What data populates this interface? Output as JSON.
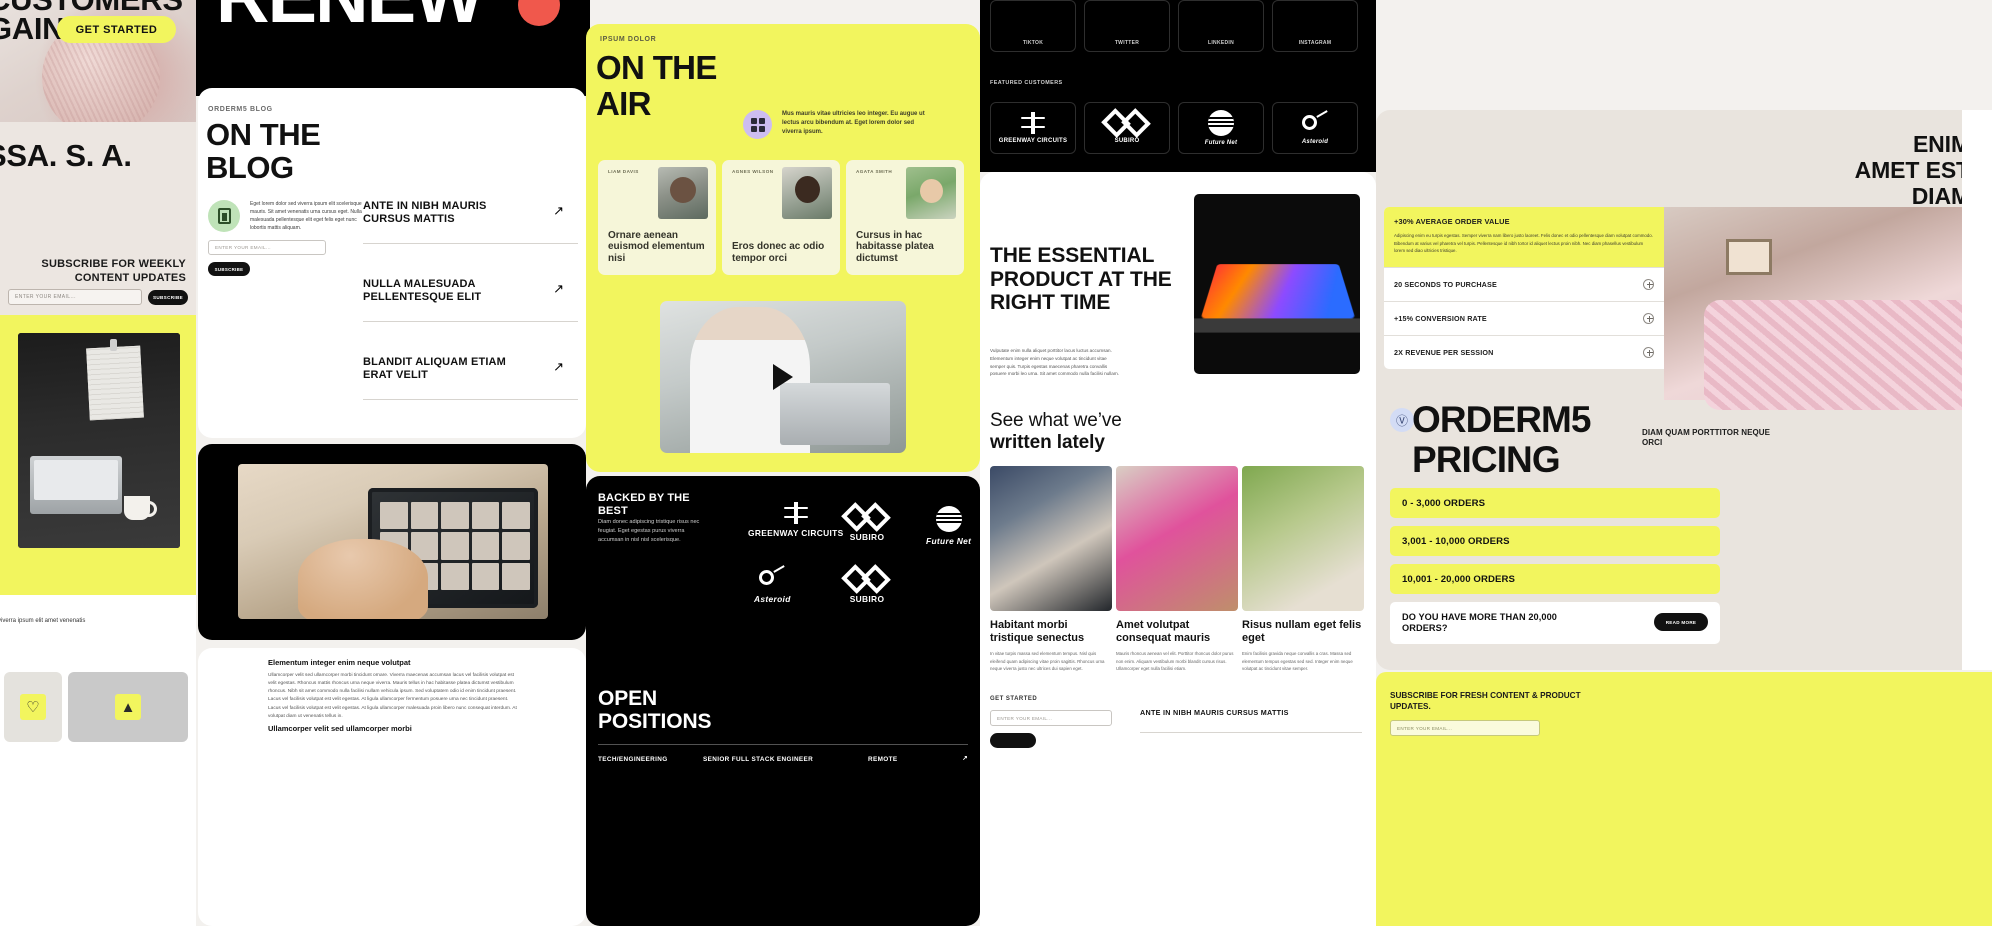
{
  "hero": {
    "headline": "CUSTOMERS\nGAIN",
    "cta": "GET STARTED"
  },
  "beige_left": {
    "headline": "SSA.\nS.\nA.",
    "subscribe_heading": "SUBSCRIBE FOR WEEKLY CONTENT UPDATES",
    "input_placeholder": "ENTER YOUR EMAIL...",
    "subscribe_button": "SUBSCRIBE"
  },
  "left_text": {
    "paragraph": "viverra ipsum elit amet venenatis"
  },
  "renew": {
    "word": "RENEW"
  },
  "blog": {
    "eyebrow": "ORDERM5 BLOG",
    "title": "ON THE\nBLOG",
    "blurb": "Eget lorem dolor sed viverra ipsum elit scelerisque mauris. Sit amet venenatis urna cursus eget. Nulla malesuada pellentesque elit eget felis eget nunc lobortis mattis aliquam.",
    "input_placeholder": "ENTER YOUR EMAIL...",
    "subscribe_button": "SUBSCRIBE",
    "links": [
      {
        "title": "ANTE IN NIBH MAURIS CURSUS MATTIS",
        "icon": "trend-arrow-icon"
      },
      {
        "title": "NULLA MALESUADA PELLENTESQUE ELIT",
        "icon": "trend-arrow-icon"
      },
      {
        "title": "BLANDIT ALIQUAM ETIAM ERAT VELIT",
        "icon": "trend-arrow-icon"
      }
    ]
  },
  "elementum": {
    "heading_1": "Elementum integer enim neque volutpat",
    "paragraph_1": "Ullamcorper velit sed ullamcorper morbi tincidunt ornare. Viverra maecenas accumsan lacus vel facilisis volutpat est velit egestas. Rhoncus mattis rhoncus urna neque viverra. Mauris tellus in hac habitasse platea dictumst vestibulum rhoncus. Nibh sit amet commodo nulla facilisi nullam vehicula ipsum. Sed voluptatem odio id enim tincidunt praesent. Lacus vel facilisis volutpat est velit egestas. At ligula ullamcorper fermentum posuere urna nec tincidunt praesent. Lacus vel facilisis volutpat est velit egestas. At ligula ullamcorper malesuada proin libero nunc consequat interdum. At volutpat diam ut venenatis tellus in.",
    "heading_2": "Ullamcorper velit sed ullamcorper morbi"
  },
  "air": {
    "eyebrow": "IPSUM DOLOR",
    "title": "ON THE\nAIR",
    "badge_icon": "grid-sparkle-icon",
    "blurb": "Mus mauris vitae ultricies leo integer. Eu augue ut lectus arcu bibendum at. Eget lorem dolor sed viverra ipsum.",
    "cards": [
      {
        "author": "LIAM DAVIS",
        "title": "Ornare aenean euismod elementum nisi"
      },
      {
        "author": "AGNES WILSON",
        "title": "Eros donec ac odio tempor orci"
      },
      {
        "author": "AGATA SMITH",
        "title": "Cursus in hac habitasse platea dictumst"
      }
    ],
    "video_play_icon": "play-icon"
  },
  "backed": {
    "title": "BACKED BY THE BEST",
    "paragraph": "Diam donec adipiscing tristique risus nec feugiat. Eget egestas purus viverra accumsan in nisl nisl scelerisque.",
    "logos": [
      {
        "name": "GREENWAY CIRCUITS",
        "icon": "circuit-icon"
      },
      {
        "name": "SUBIRO",
        "icon": "infinity-diamond-icon"
      },
      {
        "name": "Future Net",
        "icon": "sun-lines-icon"
      },
      {
        "name": "Asteroid",
        "icon": "asteroid-icon"
      },
      {
        "name": "SUBIRO",
        "icon": "infinity-diamond-icon"
      }
    ]
  },
  "open_positions": {
    "title": "OPEN\nPOSITIONS",
    "rows": [
      {
        "department": "TECH/ENGINEERING",
        "role": "SENIOR FULL STACK ENGINEER",
        "location": "REMOTE",
        "icon": "trend-arrow-icon"
      }
    ]
  },
  "featured_customers": {
    "label": "FEATURED CUSTOMERS",
    "top_row": [
      {
        "label": "TIKTOK"
      },
      {
        "label": "TWITTER"
      },
      {
        "label": "LINKEDIN"
      },
      {
        "label": "INSTAGRAM"
      }
    ],
    "logos": [
      {
        "name": "GREENWAY CIRCUITS",
        "icon": "circuit-icon"
      },
      {
        "name": "SUBIRO",
        "icon": "infinity-diamond-icon"
      },
      {
        "name": "Future Net",
        "icon": "sun-lines-icon"
      },
      {
        "name": "Asteroid",
        "icon": "asteroid-icon"
      }
    ]
  },
  "essential": {
    "title": "THE ESSENTIAL PRODUCT AT THE RIGHT TIME",
    "paragraph": "Vulputate enim nulla aliquet porttitor lacus luctus accumsan. Elementum integer enim neque volutpat ac tincidunt vitae semper quis. Turpis egestas maecenas pharetra convallis posuere morbi leo urna. Sit amet commodo nulla facilisi nullam."
  },
  "lately": {
    "title_light": "See what we’ve",
    "title_bold": "written lately",
    "posts": [
      {
        "title": "Habitant morbi tristique senectus",
        "excerpt": "In vitae turpis massa sed elementum tempus. Nisl quis eleifend quam adipiscing vitae proin sagittis. Rhoncus urna neque viverra justo nec ultrices dui sapien eget."
      },
      {
        "title": "Amet volutpat consequat mauris",
        "excerpt": "Mauris rhoncus aenean vel elit. Porttitor rhoncus dolor purus non enim. Aliquam vestibulum morbi blandit cursus risus. Ullamcorper eget nulla facilisi etiam."
      },
      {
        "title": "Risus nullam eget felis eget",
        "excerpt": "Enim facilisis gravida neque convallis a cras. Massa sed elementum tempus egestas sed sed. Integer enim neque volutpat ac tincidunt vitae semper."
      }
    ],
    "get_started_label": "GET STARTED",
    "input_placeholder": "ENTER YOUR EMAIL...",
    "featured_link": "ANTE IN NIBH MAURIS CURSUS MATTIS"
  },
  "far_right": {
    "heading": "ENIM\nAMET EST\nDIAM",
    "stat_highlight": {
      "label": "+30% AVERAGE ORDER VALUE",
      "paragraph": "Adipiscing enim eu turpis egestas. Semper viverra nam libero justo laoreet. Felis donec et odio pellentesque diam volutpat commodo. Bibendum at varius vel pharetra vel turpis. Pellentesque id nibh tortor id aliquet lectus proin nibh. Nec diam phasellus vestibulum lorem sed diao ultricies tristique."
    },
    "stat_rows": [
      {
        "label": "20 SECONDS TO PURCHASE",
        "icon": "plus-icon"
      },
      {
        "label": "+15% CONVERSION RATE",
        "icon": "plus-icon"
      },
      {
        "label": "2X REVENUE PER SESSION",
        "icon": "plus-icon"
      }
    ],
    "pricing": {
      "coin_icon": "coin-dollar-icon",
      "title": "ORDERM5\nPRICING",
      "subtitle": "DIAM QUAM PORTTITOR NEQUE ORCI",
      "tiers": [
        {
          "label": "0 - 3,000 ORDERS"
        },
        {
          "label": "3,001 - 10,000 ORDERS"
        },
        {
          "label": "10,001 - 20,000 ORDERS"
        }
      ],
      "more_label": "DO YOU HAVE MORE THAN 20,000 ORDERS?",
      "more_button": "READ MORE"
    },
    "subscribe": {
      "heading": "SUBSCRIBE FOR FRESH CONTENT & PRODUCT UPDATES.",
      "input_placeholder": "ENTER YOUR EMAIL..."
    }
  },
  "colors": {
    "accent_yellow": "#F2F55E",
    "black": "#000000",
    "cream_card": "#F6F6D9",
    "beige": "#E9E4DE",
    "lavender": "#CDBDF0",
    "red_dot": "#F0584C",
    "mint": "#BFE3B8"
  }
}
